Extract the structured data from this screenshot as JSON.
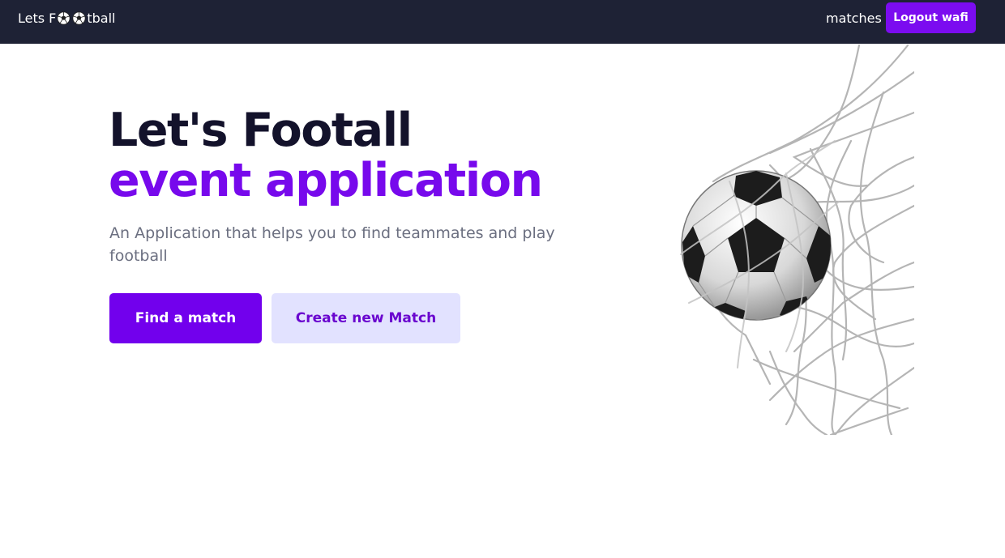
{
  "navbar": {
    "brand_prefix": "Lets F",
    "brand_suffix": "tball",
    "brand_icon": "soccer-ball-icon",
    "matches_link": "matches",
    "logout_button": "Logout wafi"
  },
  "hero": {
    "title_line1": "Let's Footall",
    "title_line2": "event application",
    "description": "An Application that helps you to find teammates and play football",
    "primary_button": "Find a match",
    "secondary_button": "Create new Match",
    "image": "soccer-ball-in-net-image"
  },
  "colors": {
    "navbar_bg": "#1e2235",
    "accent": "#7200ed",
    "secondary_button_bg": "#e2e2ff",
    "title_dark": "#13122b"
  }
}
